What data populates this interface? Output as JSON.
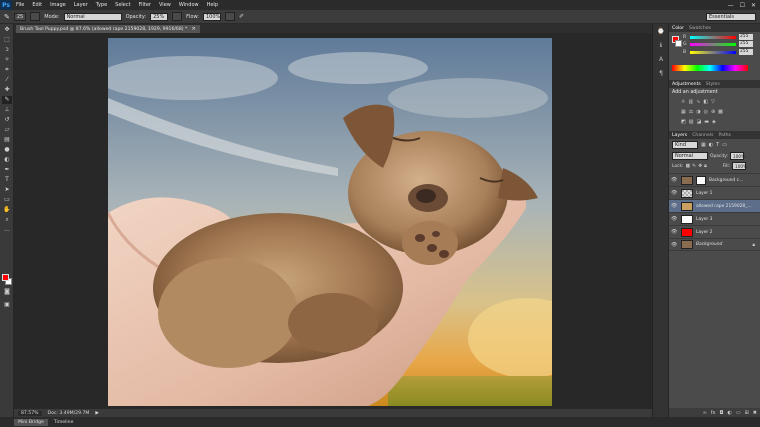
{
  "menubar": {
    "logo": "Ps",
    "items": [
      "File",
      "Edit",
      "Image",
      "Layer",
      "Type",
      "Select",
      "Filter",
      "View",
      "Window",
      "Help"
    ],
    "controls": [
      "—",
      "☐",
      "✕"
    ]
  },
  "options": {
    "size": "25",
    "mode_label": "Mode:",
    "mode_value": "Normal",
    "opacity_label": "Opacity:",
    "opacity_value": "25%",
    "flow_label": "Flow:",
    "flow_value": "100%",
    "workspace": "Essentials"
  },
  "document": {
    "tab_title": "Brush Tool Puppy.psd @ 87.6% (allowed rape 2159028, 1929, 9916/68) *",
    "close": "×"
  },
  "status": {
    "zoom": "87.57%",
    "doc": "Doc: 3.49M/29.7M",
    "arrow": "▶"
  },
  "bottom_tabs": [
    "Mini Bridge",
    "Timeline"
  ],
  "color_panel": {
    "tabs": [
      "Color",
      "Swatches"
    ],
    "channels": [
      {
        "name": "R",
        "value": "255",
        "color": "#e24b4b"
      },
      {
        "name": "G",
        "value": "255",
        "color": "#4bd24b"
      },
      {
        "name": "B",
        "value": "255",
        "color": "#4b7be2"
      }
    ]
  },
  "adjustments_panel": {
    "tabs": [
      "Adjustments",
      "Styles"
    ],
    "title": "Add an adjustment"
  },
  "layers_panel": {
    "tabs": [
      "Layers",
      "Channels",
      "Paths"
    ],
    "kind": "Kind",
    "blend": "Normal",
    "opacity_label": "Opacity:",
    "opacity": "100%",
    "lock_label": "Lock:",
    "fill_label": "Fill:",
    "fill": "100%",
    "layers": [
      {
        "name": "Background c...",
        "thumb": "#8a6d50",
        "mask": true,
        "selected": false
      },
      {
        "name": "Layer 1",
        "thumb": "#c8c8c8",
        "mask": false,
        "selected": false
      },
      {
        "name": "allowed rape 2159028_...",
        "thumb": "#c9a060",
        "mask": false,
        "selected": true
      },
      {
        "name": "Layer 3",
        "thumb": "#ffffff",
        "mask": false,
        "selected": false
      },
      {
        "name": "Layer 2",
        "thumb": "#ff0000",
        "mask": false,
        "selected": false
      },
      {
        "name": "Background",
        "thumb": "#8a6d50",
        "mask": false,
        "selected": false
      }
    ]
  },
  "colors": {
    "foreground": "#ff0000",
    "background": "#ffffff"
  }
}
